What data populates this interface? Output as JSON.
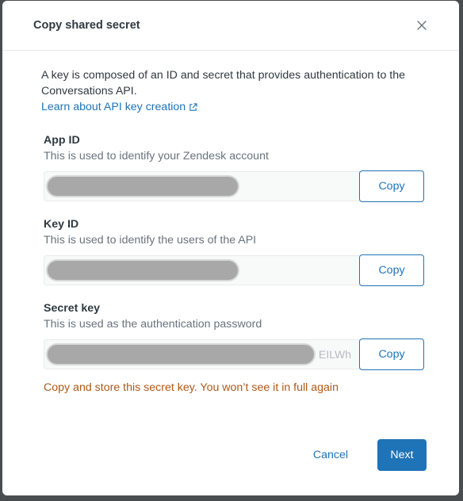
{
  "modal": {
    "title": "Copy shared secret",
    "intro": "A key is composed of an ID and secret that provides authentication to the Conversations API.",
    "learn_link": "Learn about API key creation"
  },
  "fields": {
    "app_id": {
      "label": "App ID",
      "hint": "This is used to identify your Zendesk account",
      "copy_label": "Copy"
    },
    "key_id": {
      "label": "Key ID",
      "hint": "This is used to identify the users of the API",
      "copy_label": "Copy"
    },
    "secret_key": {
      "label": "Secret key",
      "hint": "This is used as the authentication password",
      "visible_tail": "EILWh",
      "copy_label": "Copy",
      "warning": "Copy and store this secret key. You won’t see it in full again"
    }
  },
  "footer": {
    "cancel_label": "Cancel",
    "next_label": "Next"
  },
  "colors": {
    "accent": "#1f73b7",
    "warning": "#ad5918"
  },
  "icons": {
    "close": "close-icon",
    "external_link": "external-link-icon"
  }
}
